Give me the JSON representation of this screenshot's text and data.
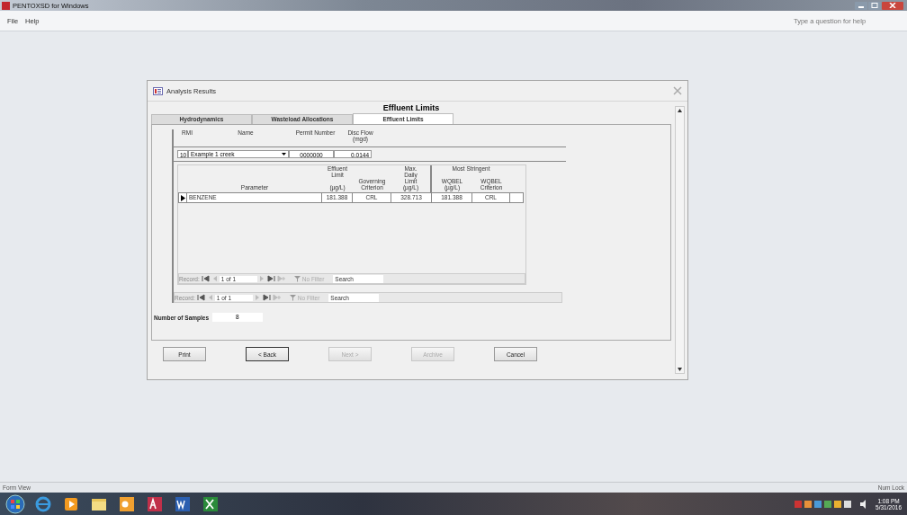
{
  "app": {
    "title": "PENTOXSD for Windows",
    "menu": [
      "File",
      "Help"
    ],
    "help_placeholder": "Type a question for help"
  },
  "dialog": {
    "title": "Analysis Results",
    "heading": "Effluent Limits",
    "tabs": [
      {
        "label": "Hydrodynamics",
        "selected": false
      },
      {
        "label": "Wasteload Allocations",
        "selected": false
      },
      {
        "label": "Effluent Limits",
        "selected": true
      }
    ],
    "discharge": {
      "columns": [
        "RMI",
        "Name",
        "Permit Number",
        "Disc Flow\n(mgd)"
      ],
      "rmi": "10",
      "name": "Example 1 creek",
      "permit": "0000000",
      "flow": "0.0144"
    },
    "limits_table": {
      "group_headers": [
        "Effluent Limit",
        "Most Stringent"
      ],
      "columns": [
        "Parameter",
        "(µg/L)",
        "Governing\nCriterion",
        "Max.\nDaily\nLimit\n(µg/L)",
        "WQBEL\n(µg/L)",
        "WQBEL\nCriterion"
      ],
      "rows": [
        {
          "selected": true,
          "cells": [
            "BENZENE",
            "181.388",
            "CRL",
            "328.713",
            "181.388",
            "CRL"
          ]
        }
      ]
    },
    "navigators": [
      {
        "label": "Record:",
        "position": "1 of 1",
        "filter": "No Filter",
        "search_placeholder": "Search"
      },
      {
        "label": "Record:",
        "position": "1 of 1",
        "filter": "No Filter",
        "search_placeholder": "Search"
      }
    ],
    "samples": {
      "label": "Number of Samples",
      "value": "8"
    },
    "buttons": [
      {
        "label": "Print",
        "disabled": false,
        "default": false
      },
      {
        "label": "< Back",
        "disabled": false,
        "default": true
      },
      {
        "label": "Next >",
        "disabled": true,
        "default": false
      },
      {
        "label": "Archive",
        "disabled": true,
        "default": false
      },
      {
        "label": "Cancel",
        "disabled": false,
        "default": false
      }
    ]
  },
  "status_bar": {
    "left": "Form View",
    "right": "Num Lock"
  },
  "taskbar": {
    "time": "1:08 PM",
    "date": "5/31/2016"
  }
}
